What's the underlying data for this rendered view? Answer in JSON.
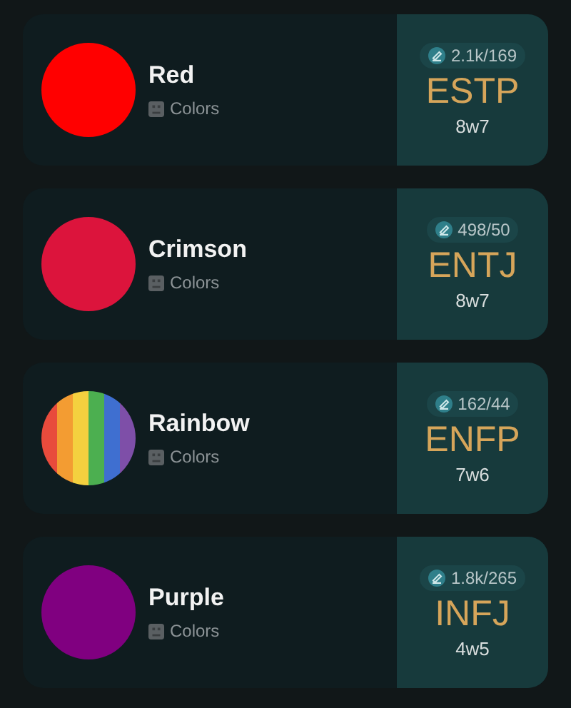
{
  "profiles": [
    {
      "name": "Red",
      "category": "Colors",
      "swatch": {
        "kind": "solid",
        "color": "#ff0000"
      },
      "votes": "2.1k/169",
      "type": "ESTP",
      "enneagram": "8w7"
    },
    {
      "name": "Crimson",
      "category": "Colors",
      "swatch": {
        "kind": "solid",
        "color": "#dc143c"
      },
      "votes": "498/50",
      "type": "ENTJ",
      "enneagram": "8w7"
    },
    {
      "name": "Rainbow",
      "category": "Colors",
      "swatch": {
        "kind": "stripes"
      },
      "votes": "162/44",
      "type": "ENFP",
      "enneagram": "7w6"
    },
    {
      "name": "Purple",
      "category": "Colors",
      "swatch": {
        "kind": "solid",
        "color": "#800080"
      },
      "votes": "1.8k/265",
      "type": "INFJ",
      "enneagram": "4w5"
    }
  ]
}
